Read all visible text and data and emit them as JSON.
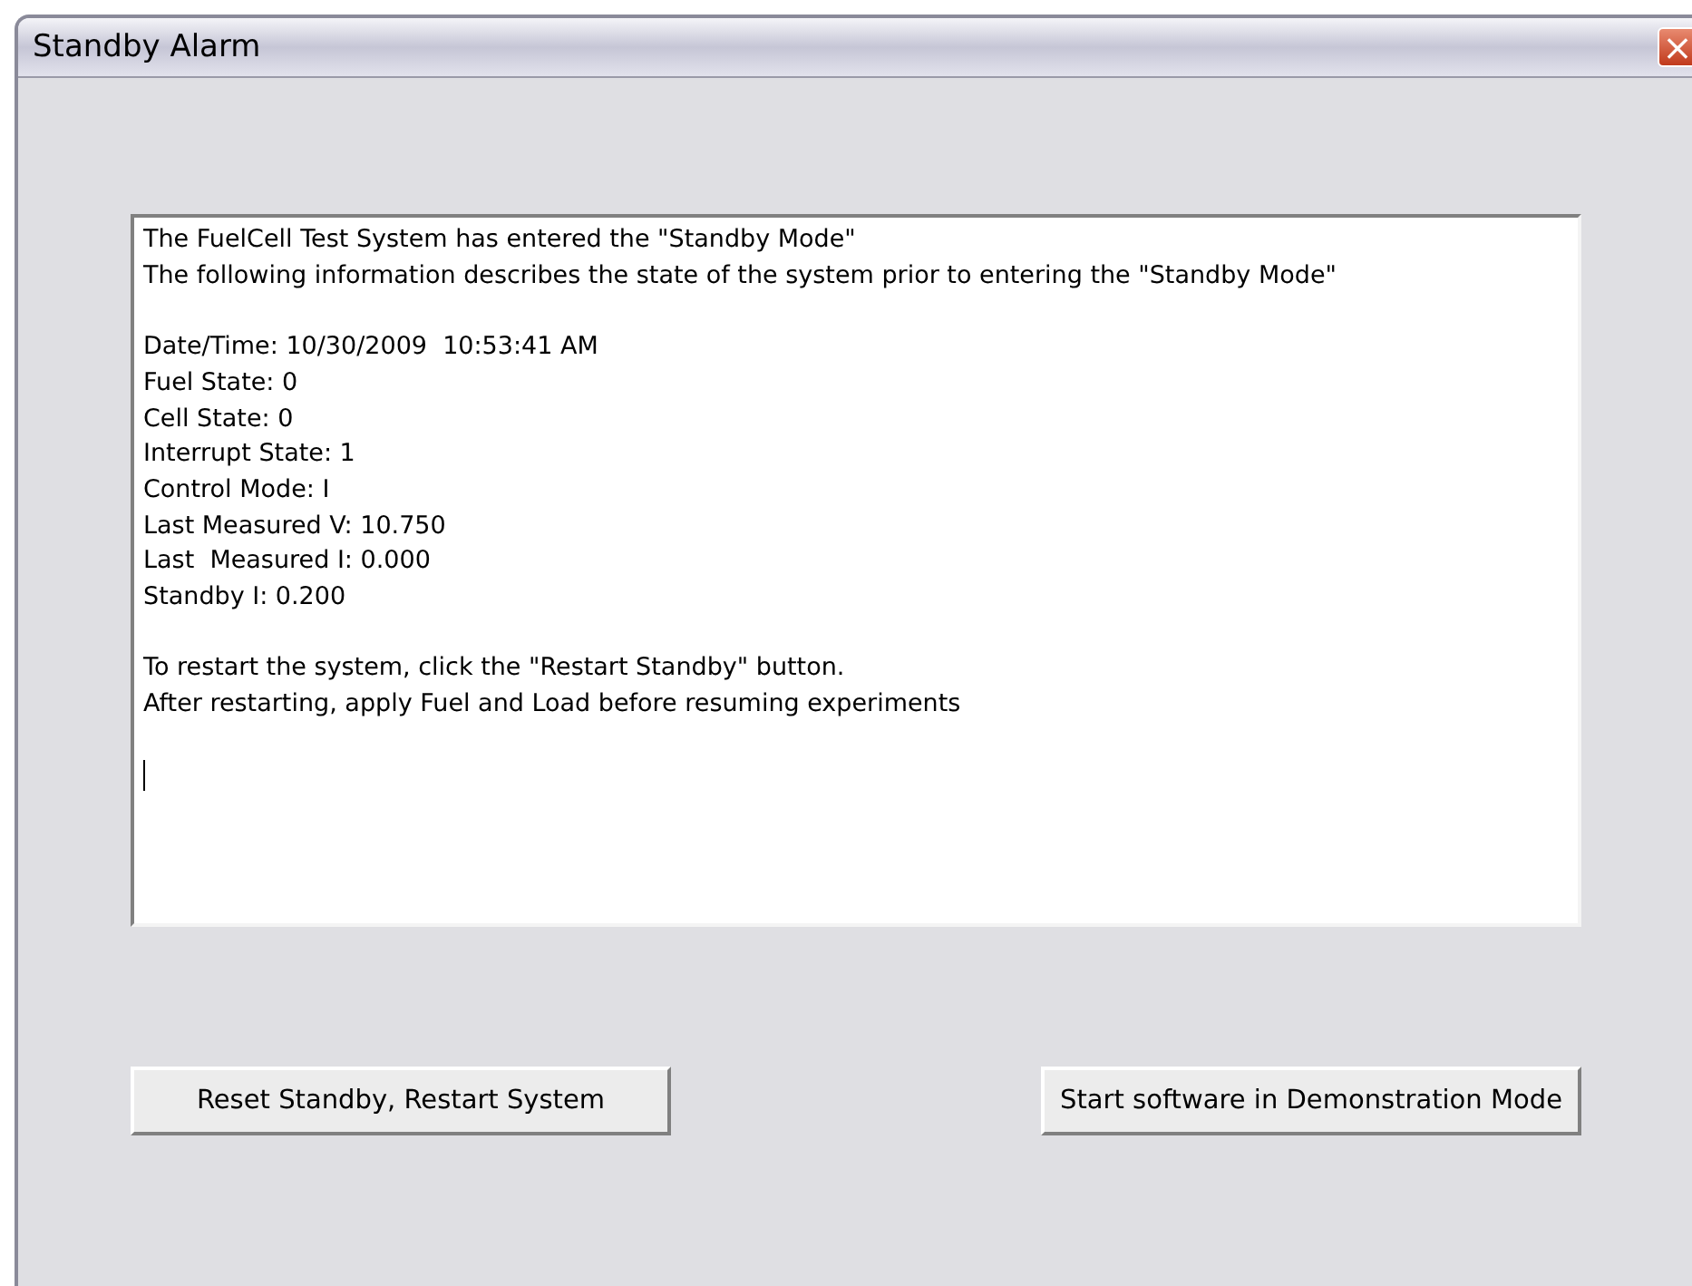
{
  "window": {
    "title": "Standby Alarm",
    "close_icon": "×"
  },
  "message_box": {
    "paragraphs": [
      [
        "The FuelCell Test System has entered the \"Standby Mode\"",
        "The following information describes the state of the system prior to entering the \"Standby Mode\""
      ],
      [
        "Date/Time: 10/30/2009  10:53:41 AM",
        "Fuel State: 0",
        "Cell State: 0",
        "Interrupt State: 1",
        "Control Mode: I",
        "Last Measured V: 10.750",
        "Last  Measured I: 0.000",
        "Standby I: 0.200"
      ],
      [
        "To restart the system, click the \"Restart Standby\" button.",
        "After restarting, apply Fuel and Load before resuming experiments"
      ]
    ],
    "caret": true
  },
  "buttons": [
    "Reset Standby, Restart System",
    "Start software in Demonstration Mode"
  ]
}
